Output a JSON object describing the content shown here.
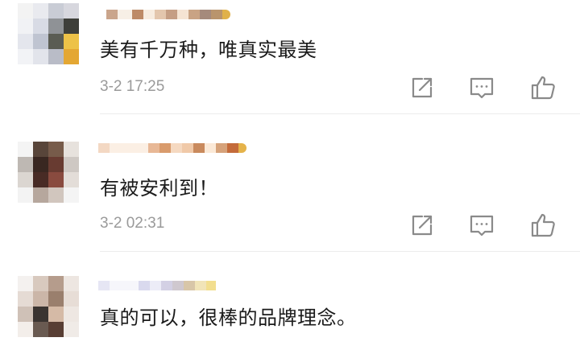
{
  "comments": [
    {
      "text": "美有千万种，唯真实最美",
      "time": "3-2 17:25",
      "actions": [
        "share-icon",
        "reply-icon",
        "like-icon"
      ]
    },
    {
      "text": "有被安利到！",
      "time": "3-2 02:31",
      "actions": [
        "share-icon",
        "reply-icon",
        "like-icon"
      ]
    },
    {
      "text": "真的可以，很棒的品牌理念。",
      "time": "",
      "actions": []
    }
  ],
  "colors": {
    "text": "#1b1b1b",
    "time": "#9a9a9a",
    "icon": "#8a8a8a",
    "divider": "#ececec"
  }
}
